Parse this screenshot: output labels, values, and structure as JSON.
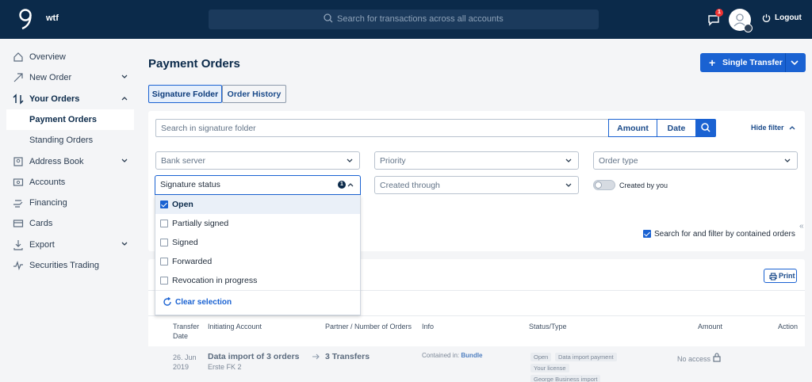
{
  "header": {
    "brand": "wtf",
    "search_placeholder": "Search for transactions across all accounts",
    "notifications_count": "1",
    "logout_label": "Logout"
  },
  "sidebar": {
    "items": [
      {
        "label": "Overview",
        "icon": "home-icon"
      },
      {
        "label": "New Order",
        "icon": "arrow-up-right-icon"
      },
      {
        "label": "Your Orders",
        "icon": "swap-icon"
      },
      {
        "label": "Payment Orders"
      },
      {
        "label": "Standing Orders"
      },
      {
        "label": "Address Book",
        "icon": "contact-icon"
      },
      {
        "label": "Accounts",
        "icon": "accounts-icon"
      },
      {
        "label": "Financing",
        "icon": "financing-icon"
      },
      {
        "label": "Cards",
        "icon": "card-icon"
      },
      {
        "label": "Export",
        "icon": "download-icon"
      },
      {
        "label": "Securities Trading",
        "icon": "chart-line-icon"
      }
    ]
  },
  "main": {
    "title": "Payment Orders",
    "transfer_button": "Single Transfer",
    "tabs": [
      "Signature Folder",
      "Order History"
    ],
    "folder_search_placeholder": "Search in signature folder",
    "amount_label": "Amount",
    "date_label": "Date",
    "hide_filter": "Hide filter",
    "filters": {
      "bank_server": "Bank server",
      "priority": "Priority",
      "order_type": "Order type",
      "signature_status": "Signature status",
      "signature_status_count": "1",
      "created_through": "Created through",
      "created_by_you": "Created by you"
    },
    "contained_orders": "Search for and filter by contained orders",
    "print": "Print"
  },
  "dropdown": {
    "options": [
      {
        "label": "Open",
        "checked": true
      },
      {
        "label": "Partially signed",
        "checked": false
      },
      {
        "label": "Signed",
        "checked": false
      },
      {
        "label": "Forwarded",
        "checked": false
      },
      {
        "label": "Revocation in progress",
        "checked": false
      }
    ],
    "clear_selection": "Clear selection"
  },
  "table": {
    "headers": {
      "transfer_date_1": "Transfer",
      "transfer_date_2": "Date",
      "initiating_account": "Initiating Account",
      "partner": "Partner / Number of Orders",
      "info": "Info",
      "status_type": "Status/Type",
      "amount": "Amount",
      "action": "Action"
    },
    "row": {
      "date_1": "26. Jun",
      "date_2": "2019",
      "account_title": "Data import of 3 orders",
      "account_sub": "Erste FK 2",
      "partner": "3 Transfers",
      "info_prefix": "Contained in:",
      "info_link": "Bundle",
      "tags": [
        "Open",
        "Data import payment",
        "Your license",
        "George Business import"
      ],
      "amount": "No access"
    }
  },
  "colors": {
    "primary": "#1a62d2",
    "topbar": "#0b2a4a"
  }
}
